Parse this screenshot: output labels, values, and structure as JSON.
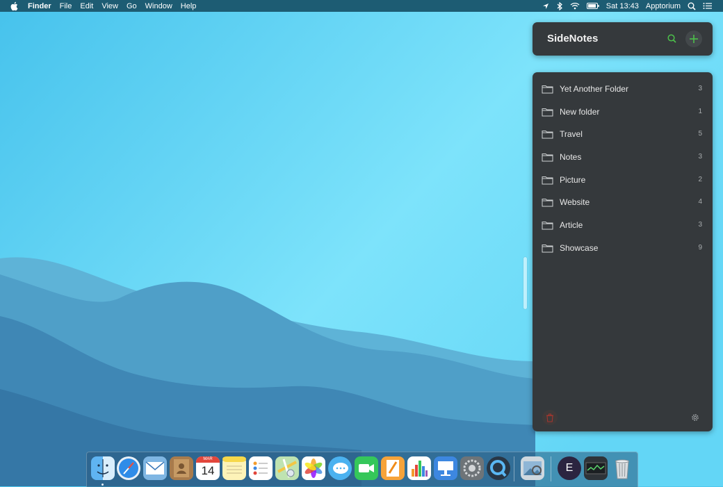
{
  "menubar": {
    "app_name": "Finder",
    "menus": [
      "File",
      "Edit",
      "View",
      "Go",
      "Window",
      "Help"
    ],
    "clock": "Sat 13:43",
    "user": "Apptorium"
  },
  "sidenotes": {
    "title": "SideNotes",
    "accent": "#4cc04b",
    "folders": [
      {
        "name": "Yet Another Folder",
        "count": "3"
      },
      {
        "name": "New folder",
        "count": "1"
      },
      {
        "name": "Travel",
        "count": "5"
      },
      {
        "name": "Notes",
        "count": "3"
      },
      {
        "name": "Picture",
        "count": "2"
      },
      {
        "name": "Website",
        "count": "4"
      },
      {
        "name": "Article",
        "count": "3"
      },
      {
        "name": "Showcase",
        "count": "9"
      }
    ]
  },
  "dock": {
    "apps": [
      "Finder",
      "Safari",
      "Mail",
      "Contacts",
      "Calendar",
      "Notes",
      "Reminders",
      "Maps",
      "Photos",
      "Messages",
      "FaceTime",
      "Pages",
      "Numbers",
      "Keynote",
      "System Preferences",
      "QuickTime Player",
      "Preview",
      "Evernote",
      "Activity Monitor",
      "Trash"
    ],
    "calendar_month": "MAR",
    "calendar_day": "14",
    "evernote_letter": "E"
  }
}
